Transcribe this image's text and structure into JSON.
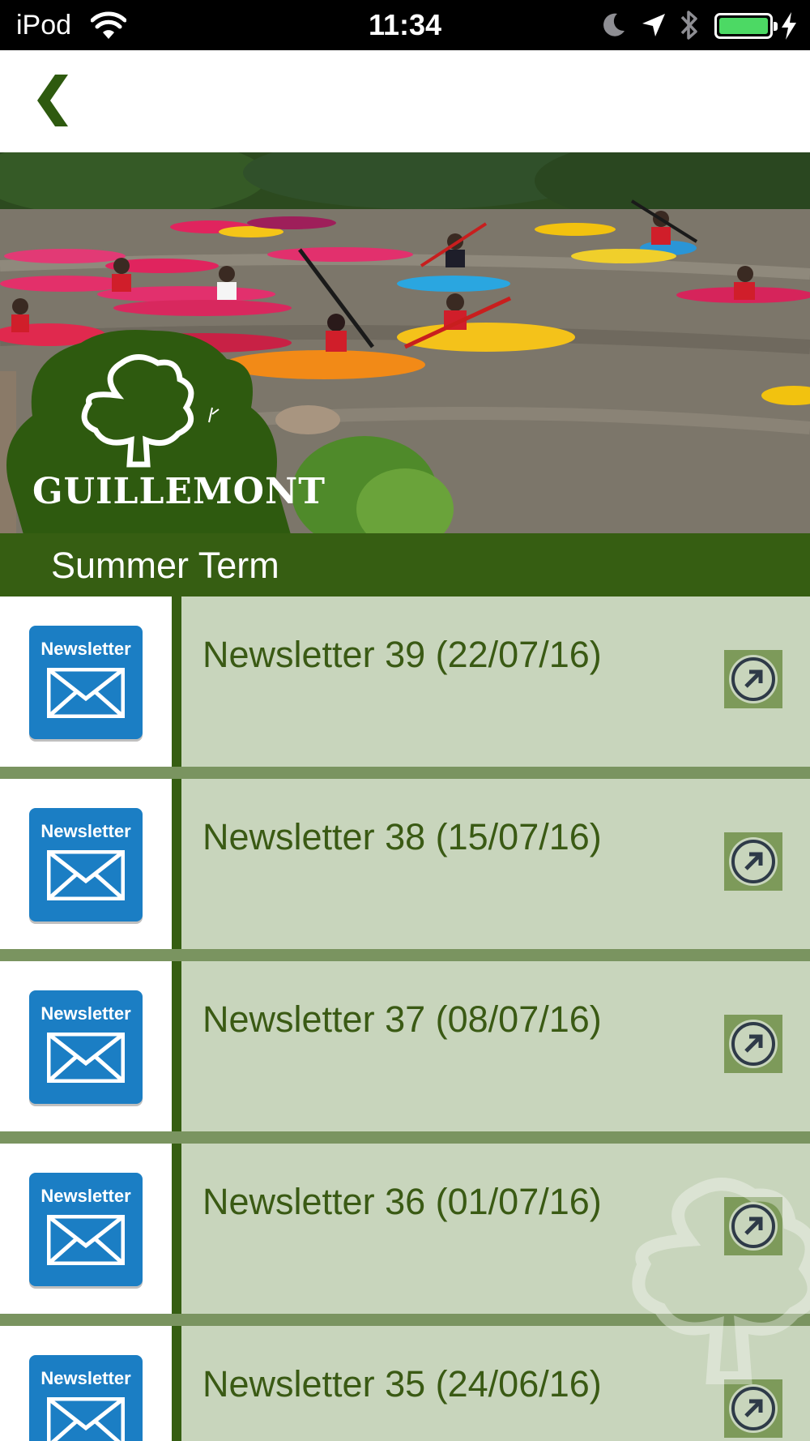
{
  "status_bar": {
    "carrier": "iPod",
    "time": "11:34",
    "battery_color": "#4cd964"
  },
  "nav": {
    "back_icon": "chevron-left-icon"
  },
  "hero": {
    "logo_text": "GUILLEMONT"
  },
  "section": {
    "title": "Summer Term"
  },
  "newsletter_icon_label": "Newsletter",
  "items": [
    {
      "title": "Newsletter 39 (22/07/16)"
    },
    {
      "title": "Newsletter 38 (15/07/16)"
    },
    {
      "title": "Newsletter 37 (08/07/16)"
    },
    {
      "title": "Newsletter 36 (01/07/16)"
    },
    {
      "title": "Newsletter 35 (24/06/16)"
    }
  ],
  "colors": {
    "brand_green": "#365e12",
    "row_bg": "#c8d5bc",
    "title_green": "#3a5a14",
    "newsletter_blue": "#1b7ec4"
  }
}
